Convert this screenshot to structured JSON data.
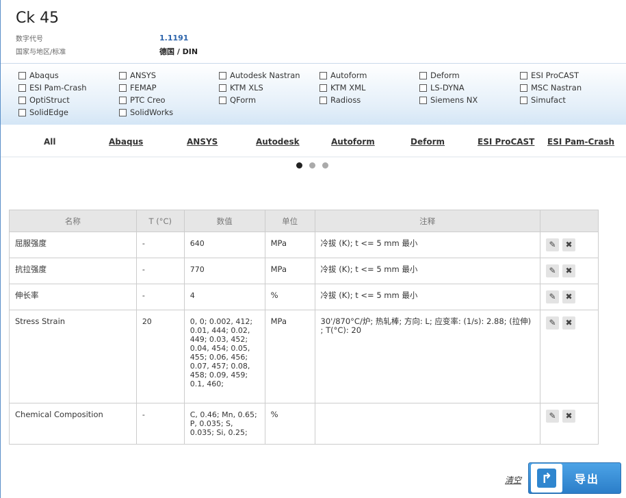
{
  "header": {
    "title": "Ck 45",
    "number_label": "数字代号",
    "number_value": "1.1191",
    "standard_label": "国家与地区/标准",
    "standard_value": "德国 / DIN"
  },
  "software_checkboxes": [
    "Abaqus",
    "ANSYS",
    "Autodesk Nastran",
    "Autoform",
    "Deform",
    "ESI ProCAST",
    "ESI Pam-Crash",
    "FEMAP",
    "KTM XLS",
    "KTM XML",
    "LS-DYNA",
    "MSC Nastran",
    "OptiStruct",
    "PTC Creo",
    "QForm",
    "Radioss",
    "Siemens NX",
    "Simufact",
    "SolidEdge",
    "SolidWorks"
  ],
  "tabs": [
    "All",
    "Abaqus",
    "ANSYS",
    "Autodesk",
    "Autoform",
    "Deform",
    "ESI ProCAST",
    "ESI Pam-Crash"
  ],
  "active_tab": "All",
  "carousel": {
    "count": 3,
    "active": 1
  },
  "table": {
    "headers": [
      "名称",
      "T (°C)",
      "数值",
      "单位",
      "注释",
      ""
    ],
    "rows": [
      {
        "name": "屈服强度",
        "temp": "-",
        "value": "640",
        "unit": "MPa",
        "note": "冷拔 (K); t <= 5 mm 最小"
      },
      {
        "name": "抗拉强度",
        "temp": "-",
        "value": "770",
        "unit": "MPa",
        "note": "冷拔 (K); t <= 5 mm 最小"
      },
      {
        "name": "伸长率",
        "temp": "-",
        "value": "4",
        "unit": "%",
        "note": "冷拔 (K); t <= 5 mm 最小"
      },
      {
        "name": "Stress Strain",
        "temp": "20",
        "value": "0, 0; 0.002, 412; 0.01, 444; 0.02, 449; 0.03, 452; 0.04, 454; 0.05, 455; 0.06, 456; 0.07, 457; 0.08, 458; 0.09, 459; 0.1, 460;",
        "unit": "MPa",
        "note": "30'/870°C/炉; 热轧棒; 方向: L; 应变率: (1/s): 2.88; (拉伸) ; T(°C): 20"
      },
      {
        "name": "Chemical Composition",
        "temp": "-",
        "value": "C, 0.46; Mn, 0.65; P, 0.035; S, 0.035; Si, 0.25;",
        "unit": "%",
        "note": ""
      }
    ]
  },
  "footer": {
    "clear_label": "清空",
    "export_label": "导出"
  }
}
